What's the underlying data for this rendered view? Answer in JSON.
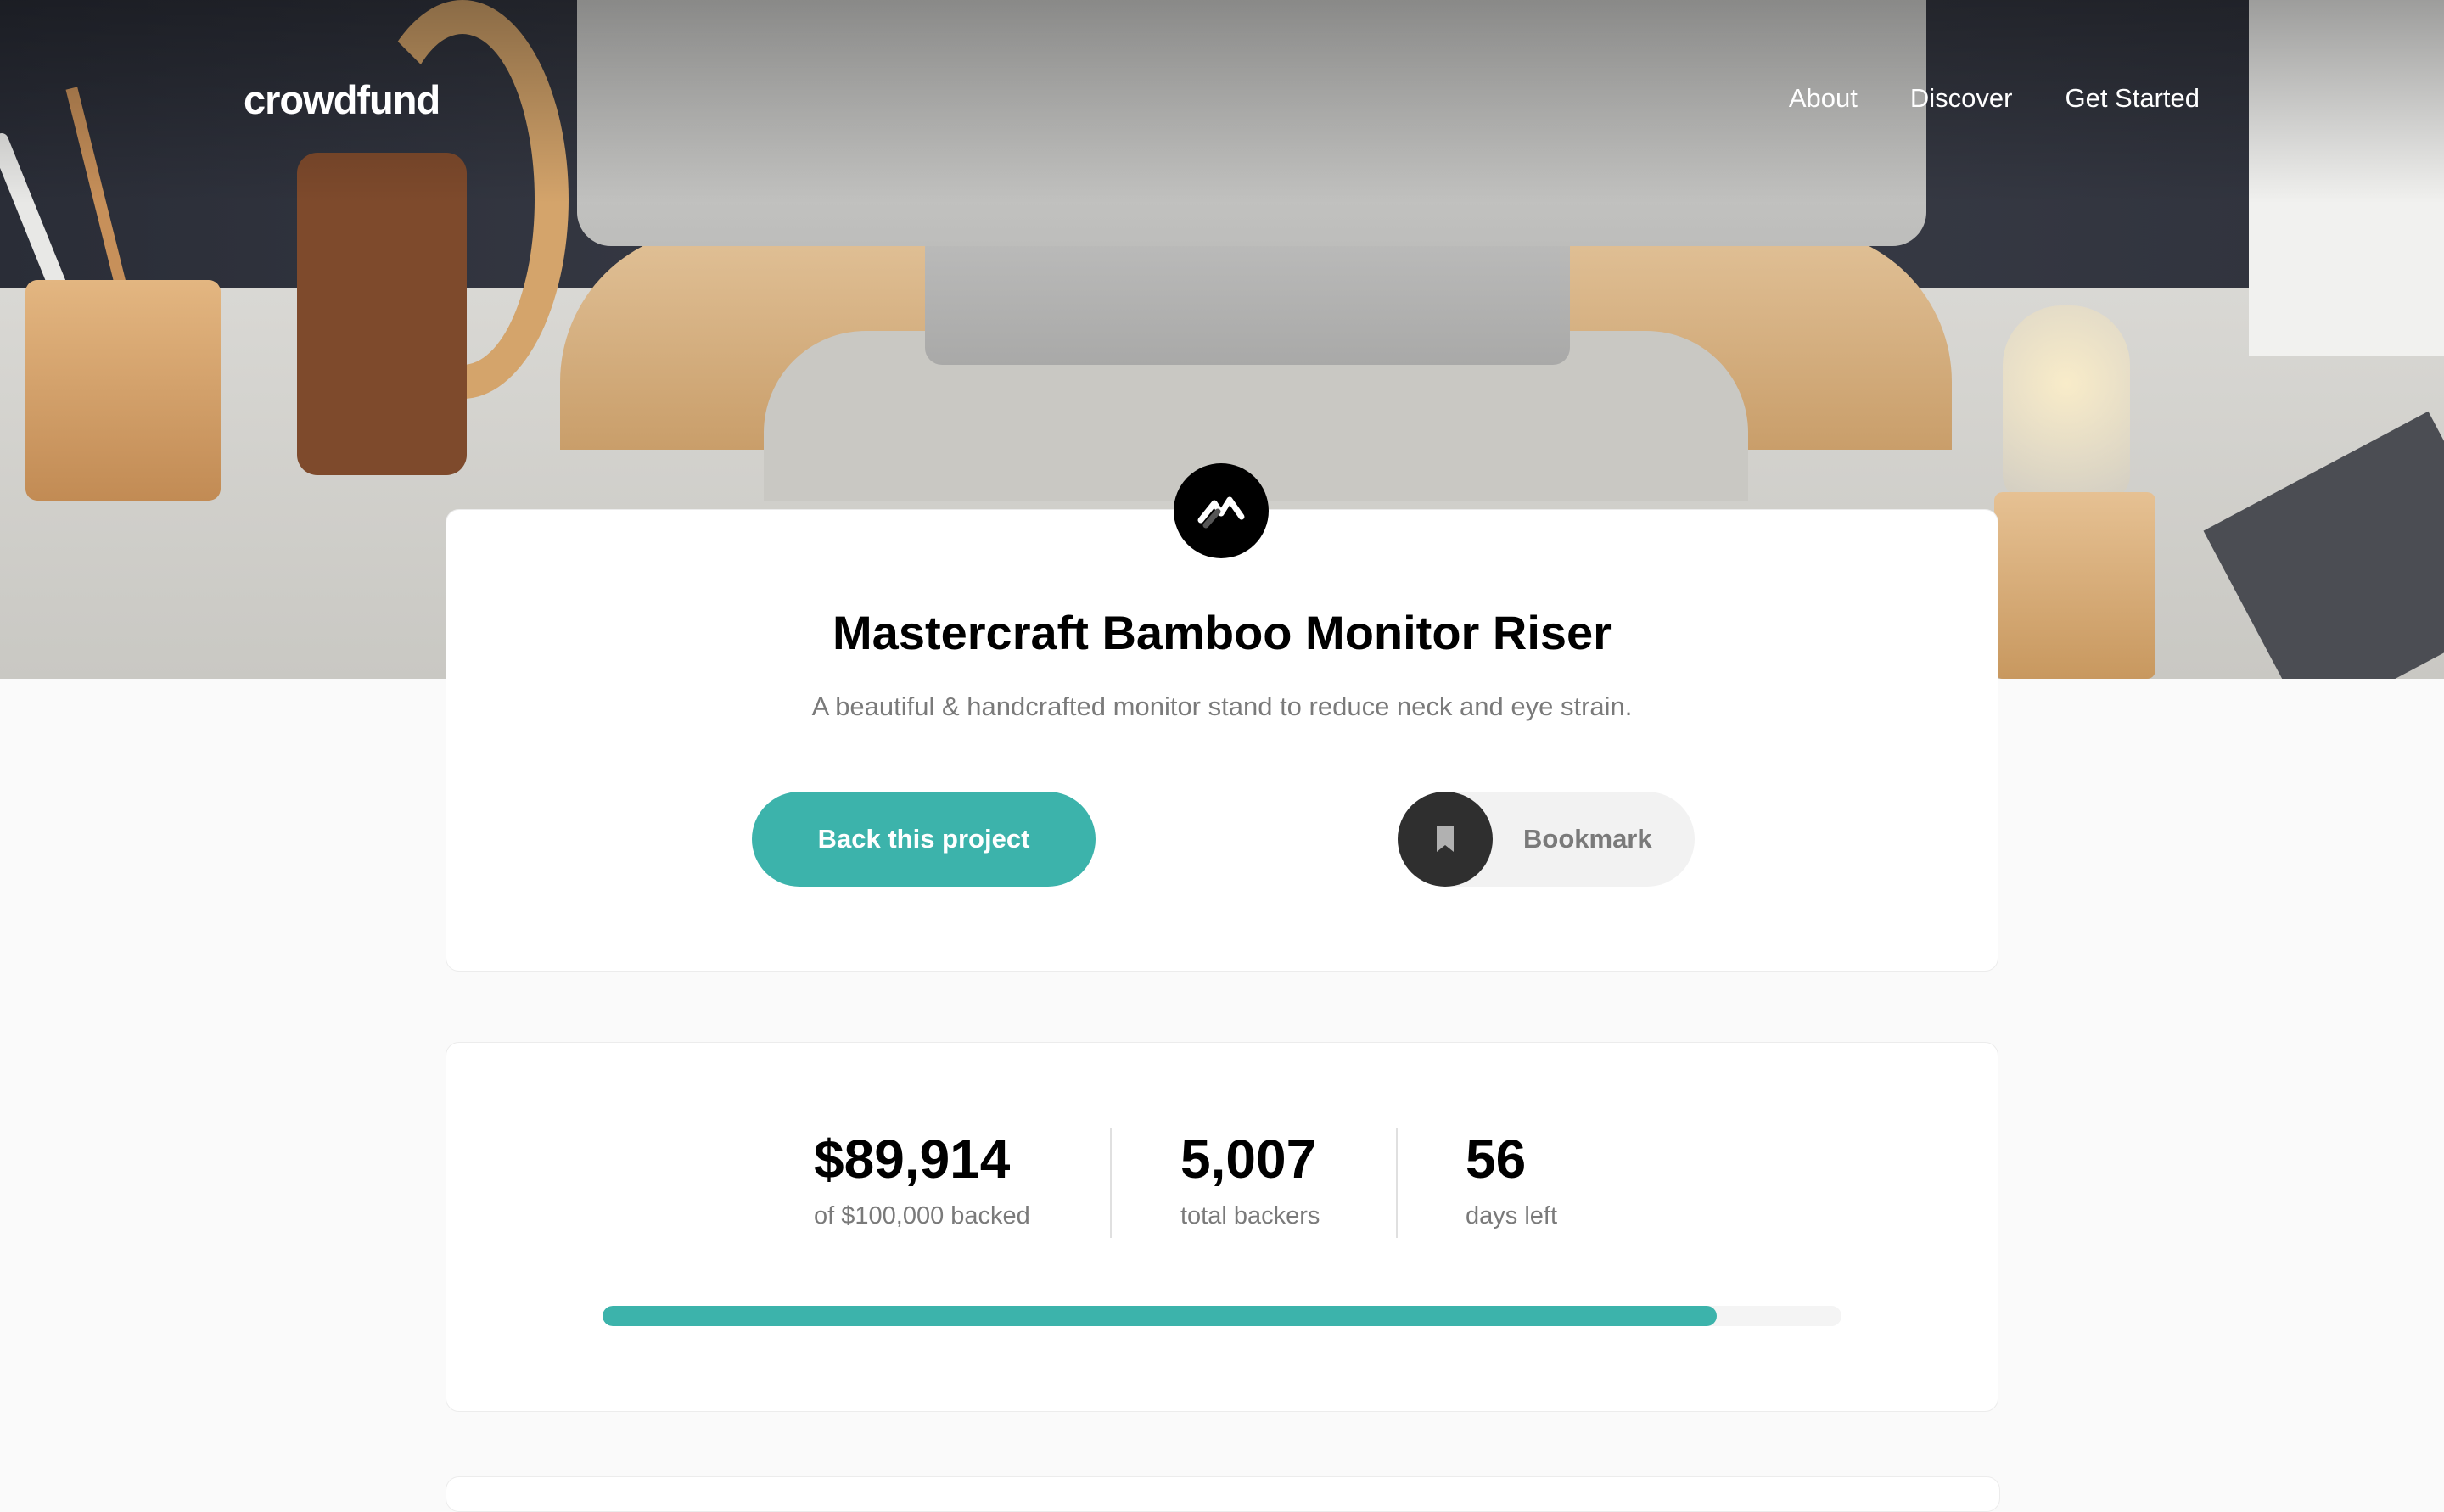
{
  "nav": {
    "logo": "crowdfund",
    "links": [
      "About",
      "Discover",
      "Get Started"
    ]
  },
  "project": {
    "title": "Mastercraft Bamboo Monitor Riser",
    "subtitle": "A beautiful & handcrafted monitor stand to reduce neck and eye strain.",
    "back_label": "Back this project",
    "bookmark_label": "Bookmark",
    "logo_icon": "mastercraft-logo-icon",
    "bookmark_icon": "bookmark-icon"
  },
  "stats": {
    "backed": {
      "value": "$89,914",
      "label": "of $100,000 backed"
    },
    "backers": {
      "value": "5,007",
      "label": "total backers"
    },
    "days": {
      "value": "56",
      "label": "days left"
    },
    "progress_fraction": 0.89914
  },
  "colors": {
    "accent": "#3cb3ab",
    "dark": "#2f2f2f",
    "muted_text": "#7a7a7a",
    "background": "#fafafa"
  }
}
